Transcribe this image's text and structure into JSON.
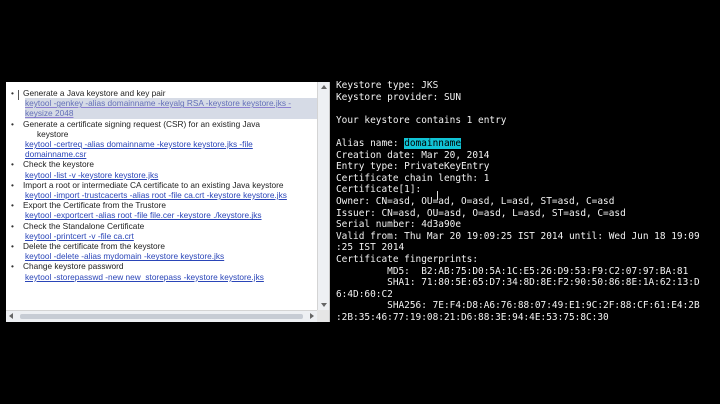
{
  "document": {
    "lines": [
      {
        "kind": "step",
        "text": "Generate a Java keystore and key pair"
      },
      {
        "kind": "cmd-sel",
        "text": "keytool -genkey -alias domainname -keyalg RSA -keystore keystore.jks -"
      },
      {
        "kind": "cmd-sel",
        "text": "keysize 2048"
      },
      {
        "kind": "step",
        "text": "Generate a certificate signing request (CSR) for an existing Java"
      },
      {
        "kind": "cont",
        "text": "keystore"
      },
      {
        "kind": "cmd",
        "text": "keytool -certreq -alias domainname -keystore keystore.jks -file"
      },
      {
        "kind": "cmd",
        "text": "domainname.csr"
      },
      {
        "kind": "step",
        "text": "Check the keystore"
      },
      {
        "kind": "cmd",
        "text": "keytool -list -v -keystore keystore.jks"
      },
      {
        "kind": "step",
        "text": "Import a root or intermediate CA certificate to an existing Java keystore"
      },
      {
        "kind": "cmd",
        "text": "keytool -import -trustcacerts -alias root -file ca.crt -keystore keystore.jks"
      },
      {
        "kind": "step",
        "text": "Export the Certificate from the Trustore"
      },
      {
        "kind": "cmd",
        "text": "keytool -exportcert -alias root -file file.cer -keystore ./keystore.jks"
      },
      {
        "kind": "step",
        "text": "Check the Standalone Certificate"
      },
      {
        "kind": "cmd",
        "text": "keytool -printcert -v -file ca.crt"
      },
      {
        "kind": "step",
        "text": "Delete the certificate from the keystore"
      },
      {
        "kind": "cmd",
        "text": "keytool -delete -alias mydomain -keystore keystore.jks"
      },
      {
        "kind": "step",
        "text": "Change keystore password"
      },
      {
        "kind": "cmd",
        "text": "keytool -storepasswd -new new_storepass -keystore keystore.jks"
      }
    ]
  },
  "terminal": {
    "l01": "Keystore type: JKS",
    "l02": "Keystore provider: SUN",
    "l03": "",
    "l04": "Your keystore contains 1 entry",
    "l05": "",
    "l06_prefix": "Alias name: ",
    "l06_highlight": "domainname",
    "l07": "Creation date: Mar 20, 2014",
    "l08": "Entry type: PrivateKeyEntry",
    "l09": "Certificate chain length: 1",
    "l10": "Certificate[1]:",
    "l11": "Owner: CN=asd, OU=ad, O=asd, L=asd, ST=asd, C=asd",
    "l12": "Issuer: CN=asd, OU=asd, O=asd, L=asd, ST=asd, C=asd",
    "l13": "Serial number: 4d3a90e",
    "l14": "Valid from: Thu Mar 20 19:09:25 IST 2014 until: Wed Jun 18 19:09",
    "l15": ":25 IST 2014",
    "l16": "Certificate fingerprints:",
    "l17": "         MD5:  B2:AB:75:D0:5A:1C:E5:26:D9:53:F9:C2:07:97:BA:81",
    "l18": "         SHA1: 71:80:5E:65:D7:34:8D:8E:F2:90:50:86:8E:1A:62:13:D",
    "l19": "6:4D:60:C2",
    "l20": "         SHA256: 7E:F4:D8:A6:76:88:07:49:E1:9C:2F:88:CF:61:E4:2B",
    "l21": ":2B:35:46:77:19:08:21:D6:88:3E:94:4E:53:75:8C:30"
  }
}
